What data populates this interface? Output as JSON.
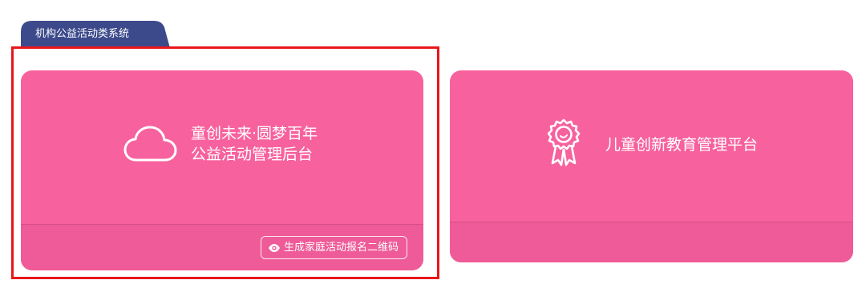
{
  "section": {
    "tab_label": "机构公益活动类系统",
    "tab_color": "#3c4a8c"
  },
  "cards": [
    {
      "icon": "cloud-icon",
      "title_line1": "童创未来·圆梦百年",
      "title_line2": "公益活动管理后台",
      "action_label": "生成家庭活动报名二维码",
      "action_icon": "eye-icon",
      "selected": true
    },
    {
      "icon": "award-badge-icon",
      "title_line1": "儿童创新教育管理平台"
    }
  ],
  "colors": {
    "card_bg": "#f7629e",
    "card_footer_bg": "#ee5b98",
    "highlight_border": "#e8161b"
  }
}
